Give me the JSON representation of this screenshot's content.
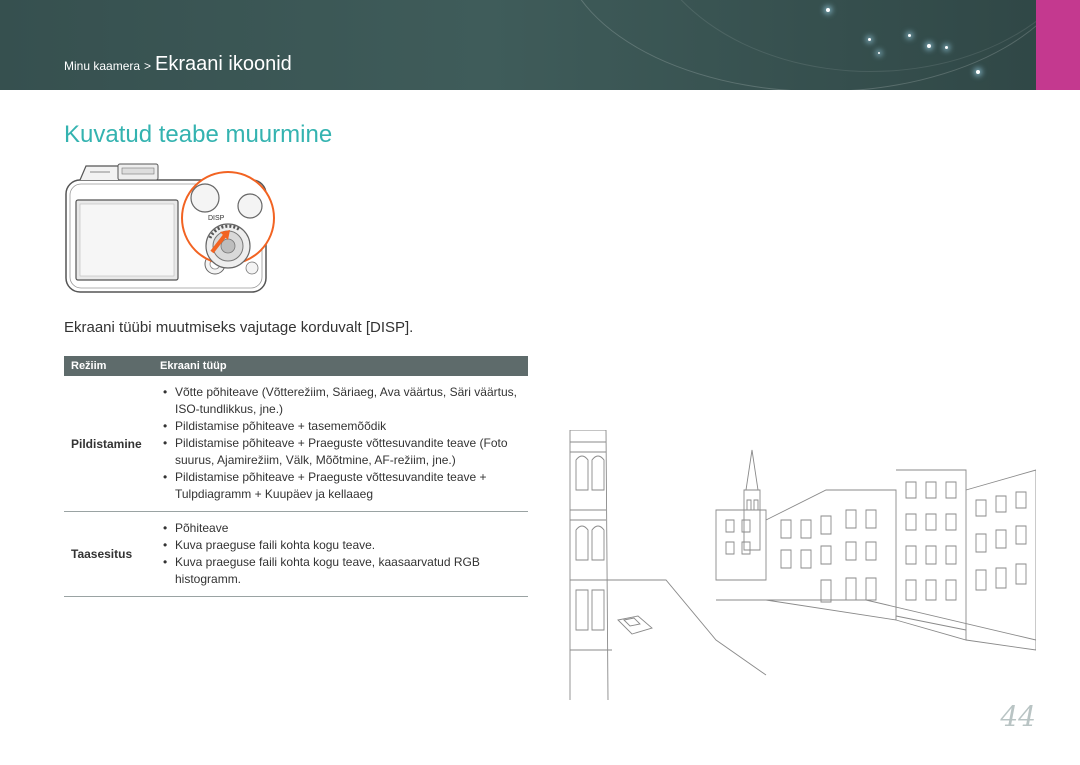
{
  "header": {
    "breadcrumb_parent": "Minu kaamera",
    "breadcrumb_separator": ">",
    "breadcrumb_current": "Ekraani ikoonid",
    "accent_color": "#c4398f",
    "background_color": "#3f5c5a"
  },
  "page": {
    "title": "Kuvatud teabe muurmine",
    "title_color": "#34b3b0",
    "instruction": "Ekraani tüübi muutmiseks vajutage korduvalt",
    "instruction_key": "[DISP].",
    "camera_button_label": "DISP",
    "page_number": "44"
  },
  "table": {
    "headers": [
      "Režiim",
      "Ekraani tüüp"
    ],
    "rows": [
      {
        "mode": "Pildistamine",
        "items": [
          "Võtte põhiteave (Võtterežiim, Säriaeg, Ava väärtus, Säri väärtus, ISO-tundlikkus, jne.)",
          "Pildistamise põhiteave + tasememõõdik",
          "Pildistamise põhiteave + Praeguste võttesuvandite teave (Foto suurus, Ajamirežiim, Välk, Mõõtmine, AF-režiim, jne.)",
          "Pildistamise põhiteave + Praeguste võttesuvandite teave + Tulpdiagramm + Kuupäev ja kellaaeg"
        ]
      },
      {
        "mode": "Taasesitus",
        "items": [
          "Põhiteave",
          "Kuva praeguse faili kohta kogu teave.",
          "Kuva praeguse faili kohta kogu teave, kaasaarvatud RGB histogramm."
        ]
      }
    ]
  }
}
